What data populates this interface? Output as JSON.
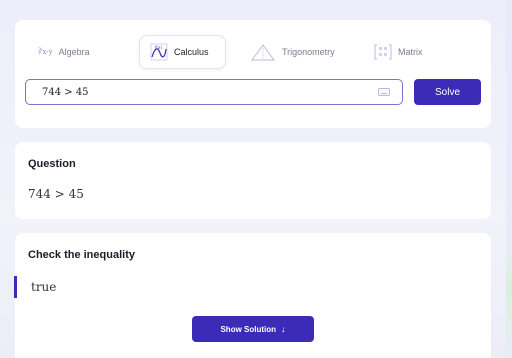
{
  "tabs": [
    {
      "label": "Algebra",
      "icon": "algebra-icon",
      "glyph": "∛x·y"
    },
    {
      "label": "Calculus",
      "icon": "calculus-icon",
      "glyph": "f(x)"
    },
    {
      "label": "Trigonometry",
      "icon": "triangle-icon"
    },
    {
      "label": "Matrix",
      "icon": "matrix-icon"
    }
  ],
  "active_tab": "Calculus",
  "input": {
    "value": "744 > 45"
  },
  "solve_label": "Solve",
  "question": {
    "title": "Question",
    "expression": "744 > 45"
  },
  "check": {
    "title": "Check the inequality",
    "result": "true"
  },
  "show_solution_label": "Show Solution",
  "show_solution_arrow": "↓",
  "colors": {
    "accent": "#3b2bb6",
    "background": "#eef0f8",
    "card": "#ffffff"
  }
}
